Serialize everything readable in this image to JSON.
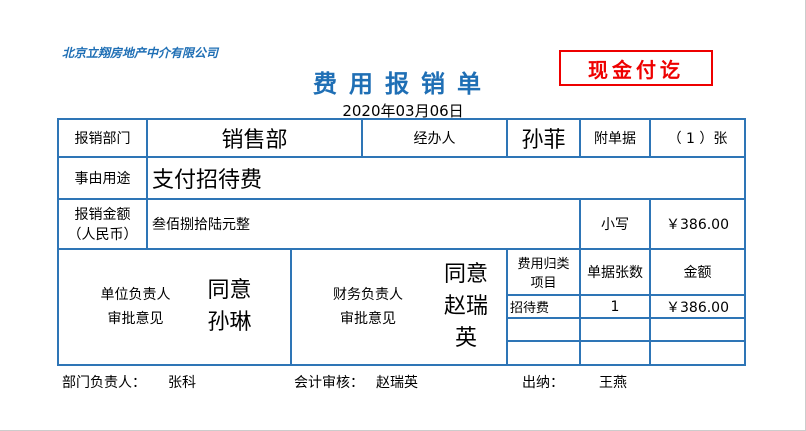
{
  "company": "北京立翔房地产中介有限公司",
  "title": "费用报销单",
  "stamp": "现金付讫",
  "date": "2020年03月06日",
  "row1": {
    "dept_label": "报销部门",
    "dept": "销售部",
    "handler_label": "经办人",
    "handler": "孙菲",
    "attach_label": "附单据",
    "attach_count": "（  1  ）张"
  },
  "row2": {
    "purpose_label": "事由用途",
    "purpose": "支付招待费"
  },
  "row3": {
    "amount_label": "报销金额（人民币）",
    "amount_upper": "叁佰捌拾陆元整",
    "small_label": "小写",
    "amount_small": "￥386.00"
  },
  "row4": {
    "unit_label": "单位负责人审批意见",
    "unit_opinion": "同意孙琳",
    "finance_label": "财务负责人审批意见",
    "finance_opinion": "同意赵瑞英",
    "headers": [
      "费用归类项目",
      "单据张数",
      "金额"
    ],
    "items": [
      {
        "category": "招待费",
        "count": "1",
        "amount": "￥386.00"
      }
    ]
  },
  "footer": {
    "dept_head_label": "部门负责人：",
    "dept_head": "张科",
    "audit_label": "会计审核：",
    "audit": "赵瑞英",
    "cashier_label": "出纳：",
    "cashier": "王燕"
  }
}
